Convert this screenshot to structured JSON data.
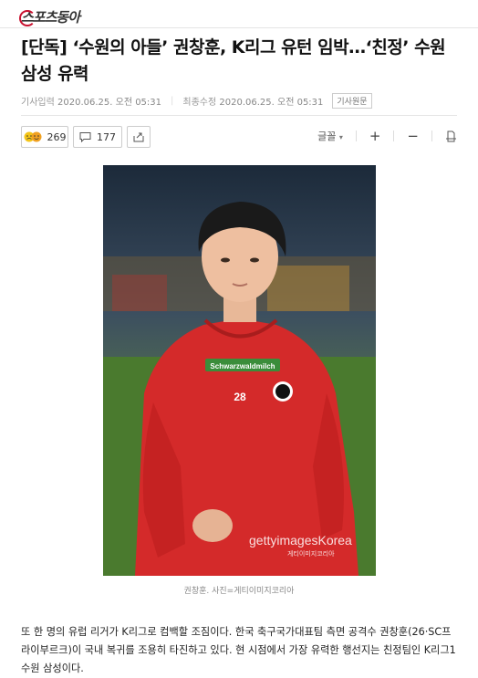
{
  "site": {
    "logo": "스포츠동아"
  },
  "article": {
    "headline": "[단독] ‘수원의 아들’ 권창훈, K리그 유턴 임박…‘친정’ 수원 삼성 유력",
    "published_label": "기사입력",
    "published": "2020.06.25. 오전 05:31",
    "updated_label": "최종수정",
    "updated": "2020.06.25. 오전 05:31",
    "original_link": "기사원문",
    "photo_watermark_brand": "gettyimages",
    "photo_watermark_suffix": "Korea",
    "photo_watermark_sub": "게티이미지코리아",
    "caption": "권창훈. 사진=게티이미지코리아",
    "body": "또 한 명의 유럽 리거가 K리그로 컴백할 조짐이다. 한국 축구국가대표팀 측면 공격수 권창훈(26·SC프라이부르크)이 국내 복귀를 조용히 타진하고 있다. 현 시점에서 가장 유력한 행선지는 친정팀인 K리그1 수원 삼성이다."
  },
  "toolbar": {
    "reaction_count": "269",
    "comment_count": "177",
    "font_label": "글꼴"
  },
  "photo_jersey": {
    "sponsor": "Schwarzwaldmilch",
    "number": "28"
  }
}
